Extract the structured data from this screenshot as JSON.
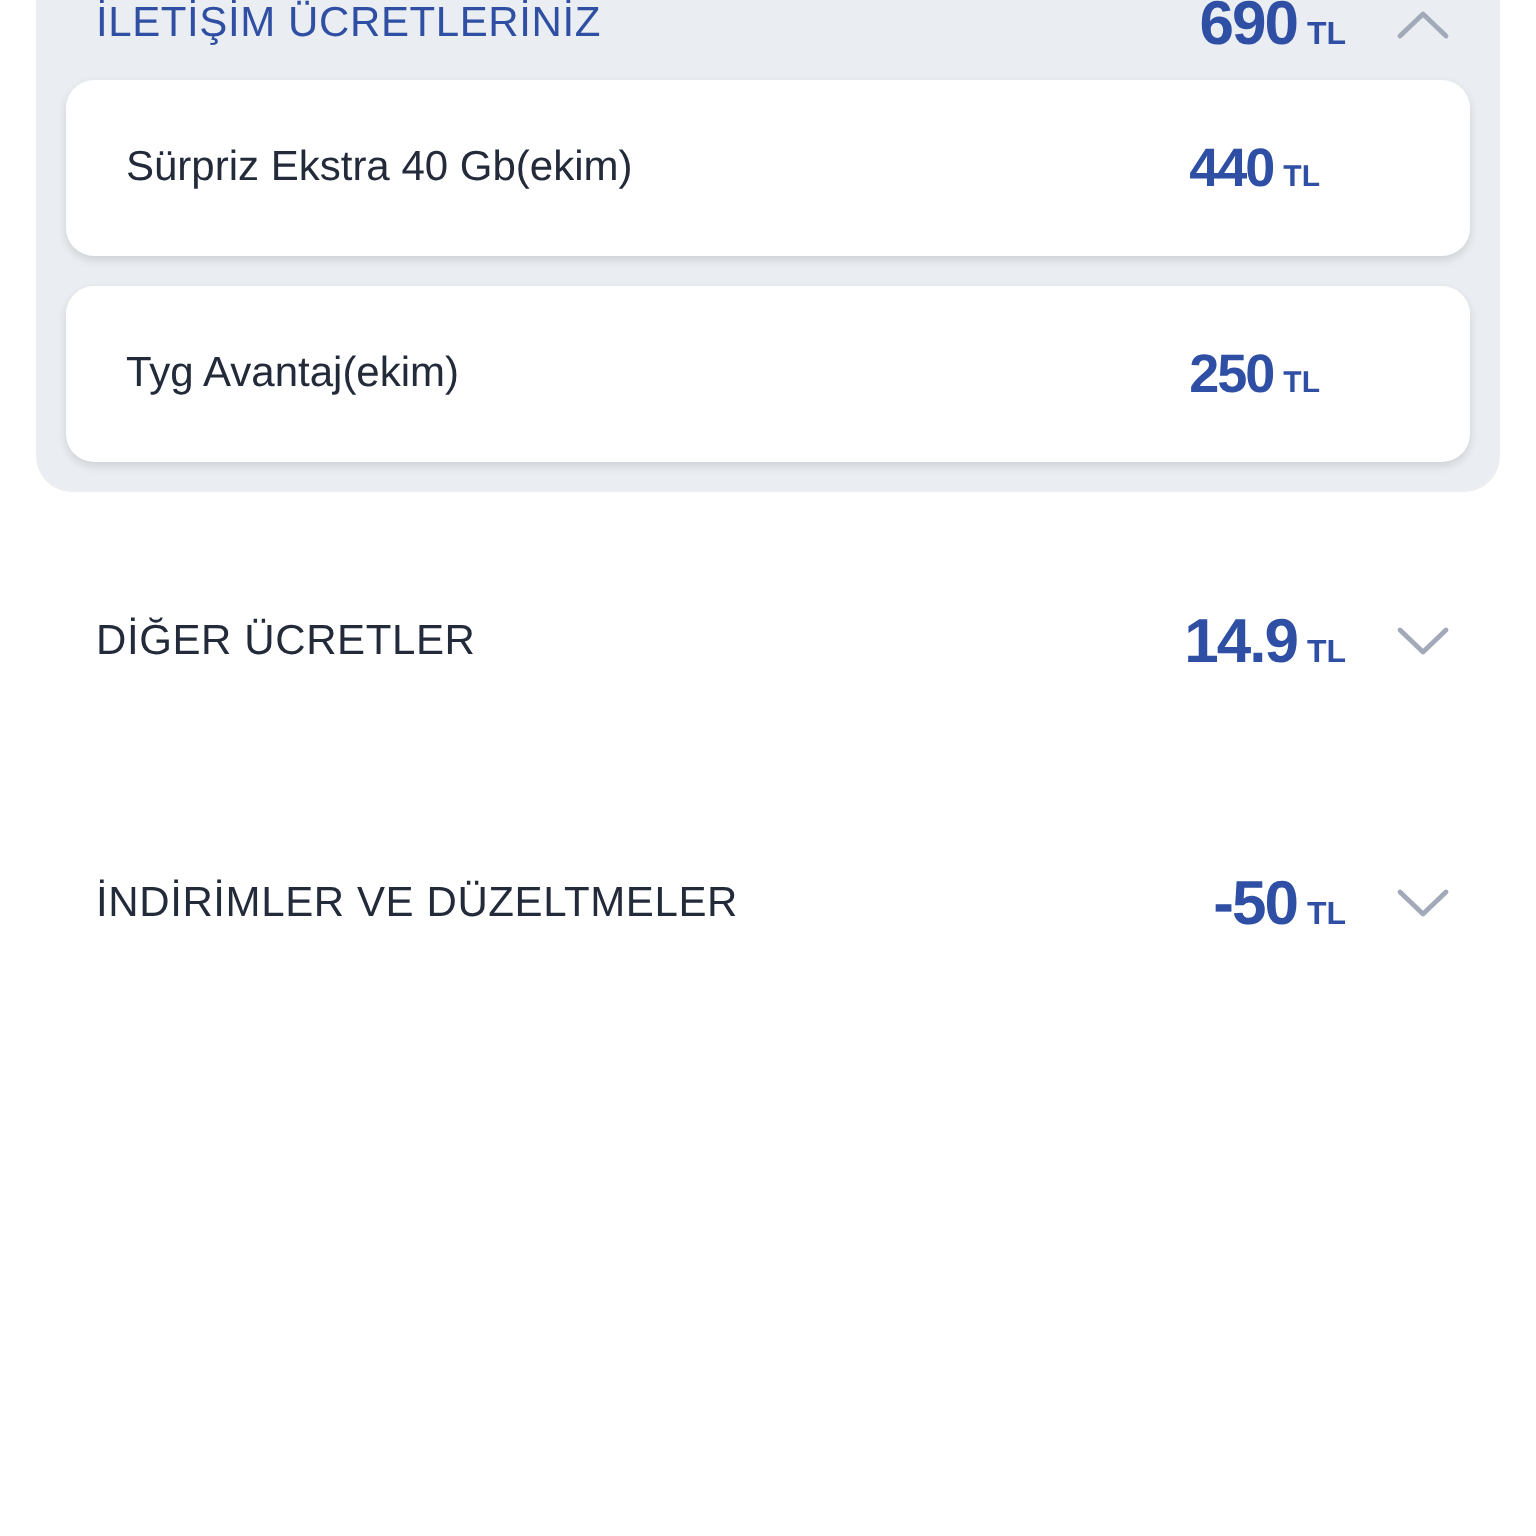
{
  "sections": [
    {
      "title": "İLETİŞİM ÜCRETLERİNİZ",
      "amount": "690",
      "unit": "TL",
      "expanded": true,
      "items": [
        {
          "name": "Sürpriz Ekstra 40 Gb(ekim)",
          "amount": "440",
          "unit": "TL"
        },
        {
          "name": "Tyg Avantaj(ekim)",
          "amount": "250",
          "unit": "TL"
        }
      ]
    },
    {
      "title": "DİĞER ÜCRETLER",
      "amount": "14.9",
      "unit": "TL",
      "expanded": false
    },
    {
      "title": "İNDİRİMLER VE DÜZELTMELER",
      "amount": "-50",
      "unit": "TL",
      "expanded": false
    }
  ]
}
